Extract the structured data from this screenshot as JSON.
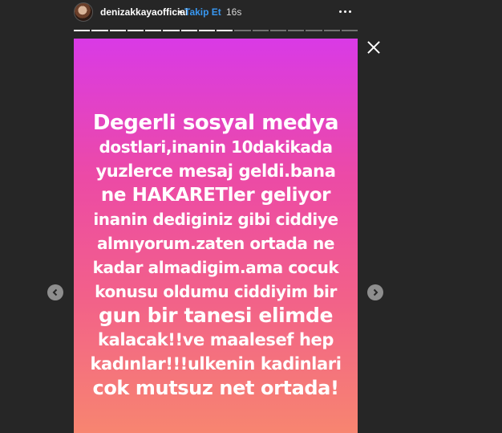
{
  "header": {
    "username": "denizakkayaofficial",
    "separator": "•",
    "follow_label": "Takip Et",
    "time_ago": "16s"
  },
  "icons": {
    "avatar": "profile-avatar",
    "more": "more-options-icon",
    "close": "close-icon",
    "prev": "chevron-left-icon",
    "next": "chevron-right-icon"
  },
  "story": {
    "progress": {
      "total_segments": 16,
      "completed_segments": 9
    },
    "lines": [
      "Degerli sosyal medya",
      "dostlari,inanin 10dakikada",
      "yuzlerce mesaj geldi.bana",
      "ne HAKARETler geliyor",
      "inanin dediginiz gibi ciddiye",
      "almıyorum.zaten ortada ne",
      "kadar almadigim.ama cocuk",
      "konusu oldumu ciddiyim bir",
      "gun bir tanesi elimde",
      "kalacak!!ve maalesef hep",
      "kadınlar!!!ulkenin kadinlari",
      "cok mutsuz net ortada!"
    ]
  },
  "colors": {
    "background": "#262626",
    "follow": "#3897f0",
    "gradient_top": "#d93ae6",
    "gradient_bottom": "#f78570"
  }
}
